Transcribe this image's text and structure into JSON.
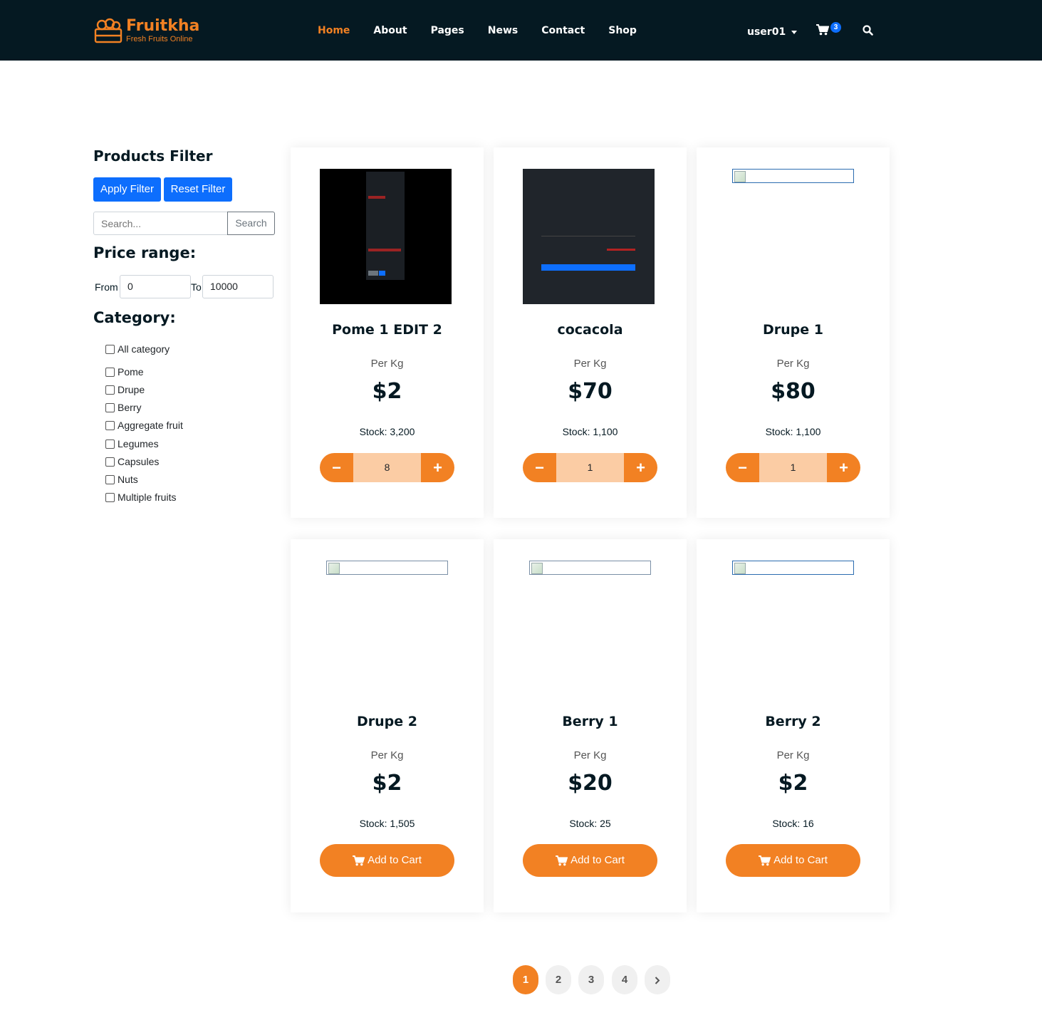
{
  "brand": {
    "name": "Fruitkha",
    "tagline": "Fresh Fruits Online",
    "accent": "#F28123",
    "header_bg": "#051922"
  },
  "nav": {
    "items": [
      {
        "label": "Home",
        "active": true
      },
      {
        "label": "About"
      },
      {
        "label": "Pages"
      },
      {
        "label": "News"
      },
      {
        "label": "Contact"
      },
      {
        "label": "Shop"
      }
    ],
    "user": "user01",
    "cart_count": "3",
    "icons": [
      "cart-icon",
      "search-icon"
    ]
  },
  "filter": {
    "title": "Products Filter",
    "apply_label": "Apply Filter",
    "reset_label": "Reset Filter",
    "search_placeholder": "Search...",
    "search_label": "Search",
    "price_title": "Price range:",
    "from_label": "From",
    "from_value": "0",
    "to_label": "To",
    "to_value": "10000",
    "category_title": "Category:",
    "categories": [
      "All category",
      "Pome",
      "Drupe",
      "Berry",
      "Aggregate fruit",
      "Legumes",
      "Capsules",
      "Nuts",
      "Multiple fruits"
    ]
  },
  "products": [
    {
      "name": "Pome 1 EDIT 2",
      "unit": "Per Kg",
      "price": "$2",
      "stock": "Stock: 3,200",
      "qty": "8",
      "image": "dark-screenshot"
    },
    {
      "name": "cocacola",
      "unit": "Per Kg",
      "price": "$70",
      "stock": "Stock: 1,100",
      "qty": "1",
      "image": "dark-screenshot"
    },
    {
      "name": "Drupe 1",
      "unit": "Per Kg",
      "price": "$80",
      "stock": "Stock: 1,100",
      "qty": "1",
      "image": "broken"
    },
    {
      "name": "Drupe 2",
      "unit": "Per Kg",
      "price": "$2",
      "stock": "Stock: 1,505",
      "cta": "Add to Cart",
      "image": "broken"
    },
    {
      "name": "Berry 1",
      "unit": "Per Kg",
      "price": "$20",
      "stock": "Stock: 25",
      "cta": "Add to Cart",
      "image": "broken"
    },
    {
      "name": "Berry 2",
      "unit": "Per Kg",
      "price": "$2",
      "stock": "Stock: 16",
      "cta": "Add to Cart",
      "image": "broken"
    }
  ],
  "pagination": {
    "pages": [
      "1",
      "2",
      "3",
      "4"
    ],
    "current": "1",
    "next_icon": "chevron-right-icon"
  }
}
